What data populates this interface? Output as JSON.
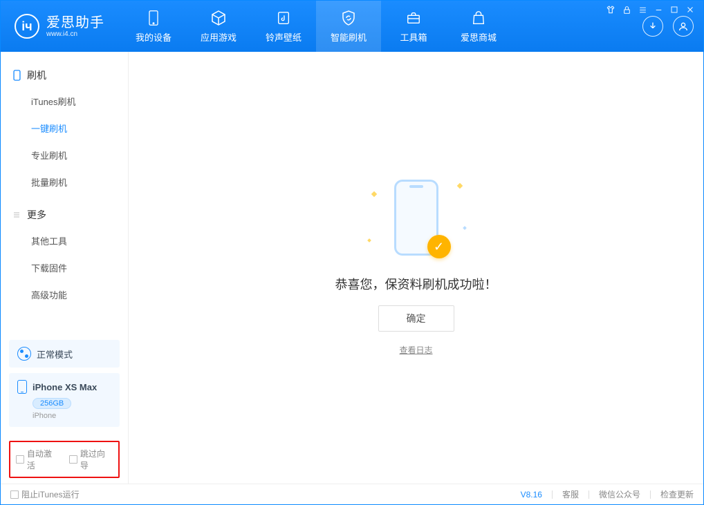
{
  "app": {
    "name_cn": "爱思助手",
    "url": "www.i4.cn"
  },
  "tabs": [
    {
      "label": "我的设备"
    },
    {
      "label": "应用游戏"
    },
    {
      "label": "铃声壁纸"
    },
    {
      "label": "智能刷机"
    },
    {
      "label": "工具箱"
    },
    {
      "label": "爱思商城"
    }
  ],
  "sidebar": {
    "section1_title": "刷机",
    "section1_items": [
      "iTunes刷机",
      "一键刷机",
      "专业刷机",
      "批量刷机"
    ],
    "section2_title": "更多",
    "section2_items": [
      "其他工具",
      "下载固件",
      "高级功能"
    ]
  },
  "mode": {
    "label": "正常模式"
  },
  "device": {
    "name": "iPhone XS Max",
    "storage": "256GB",
    "type": "iPhone"
  },
  "options": {
    "auto_activate": "自动激活",
    "skip_guide": "跳过向导"
  },
  "main": {
    "success_msg": "恭喜您，保资料刷机成功啦！",
    "ok_btn": "确定",
    "view_log": "查看日志"
  },
  "status": {
    "block_itunes": "阻止iTunes运行",
    "version": "V8.16",
    "support": "客服",
    "wechat": "微信公众号",
    "check_update": "检查更新"
  }
}
